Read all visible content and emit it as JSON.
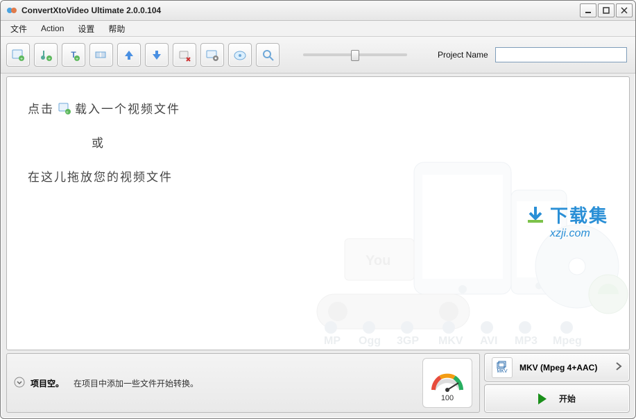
{
  "title": "ConvertXtoVideo Ultimate 2.0.0.104",
  "menu": {
    "file": "文件",
    "action": "Action",
    "settings": "设置",
    "help": "帮助"
  },
  "toolbar": {
    "icons": [
      "add-file",
      "add-audio",
      "add-text",
      "add-video-segment",
      "move-up",
      "move-down",
      "remove",
      "settings",
      "burn",
      "preview"
    ],
    "project_label": "Project Name",
    "project_value": ""
  },
  "drop": {
    "click": "点击",
    "load": "载入一个视频文件",
    "or": "或",
    "drag": "在这儿拖放您的视频文件"
  },
  "watermark": {
    "zh": "下载集",
    "en": "xzji.com"
  },
  "bg_labels": [
    "You",
    "MP",
    "Ogg",
    "3GP",
    "MKV",
    "AVI",
    "MP3",
    "Mpeg"
  ],
  "status": {
    "title": "项目空。",
    "desc": "在项目中添加一些文件开始转换。",
    "gauge": "100"
  },
  "format": {
    "label": "MKV (Mpeg 4+AAC)",
    "short": "MKV"
  },
  "start": {
    "label": "开始"
  }
}
